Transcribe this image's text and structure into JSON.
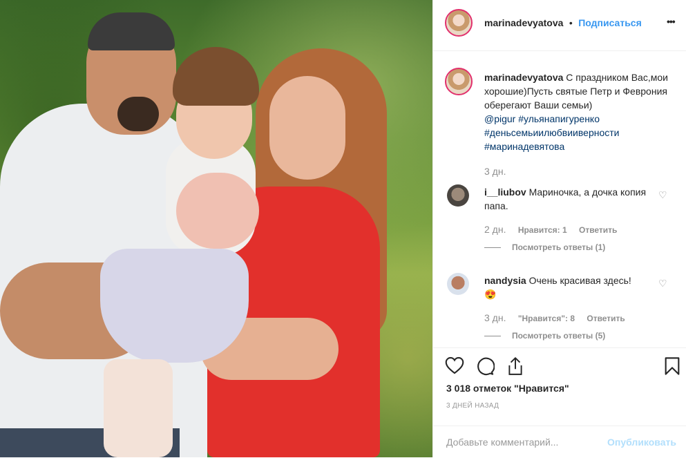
{
  "post": {
    "username": "marinadevyatova",
    "dot": "•",
    "follow": "Подписаться",
    "more": "•••"
  },
  "caption": {
    "username": "marinadevyatova",
    "text": "С праздником Вас,мои хорошие)Пусть святые Петр и Феврония оберегают Ваши семьи)",
    "mention": "@pigur",
    "tag1": "#ульянапигуренко",
    "tag2": "#деньсемьиилюбвииверности",
    "tag3": "#маринадевятова",
    "age": "3 дн."
  },
  "comments": [
    {
      "username": "i__liubov",
      "text": "Мариночка, а дочка копия папа.",
      "age": "2 дн.",
      "likes": "Нравится: 1",
      "reply": "Ответить",
      "view_replies": "Посмотреть ответы (1)"
    },
    {
      "username": "nandysia",
      "text": "Очень красивая здесь!",
      "emoji": "😍",
      "age": "3 дн.",
      "likes": "\"Нравится\": 8",
      "reply": "Ответить",
      "view_replies": "Посмотреть ответы (5)"
    }
  ],
  "likes_count": "3 018 отметок \"Нравится\"",
  "posted": "3 ДНЕЙ НАЗАД",
  "comment_box": {
    "placeholder": "Добавьте комментарий...",
    "publish": "Опубликовать"
  }
}
